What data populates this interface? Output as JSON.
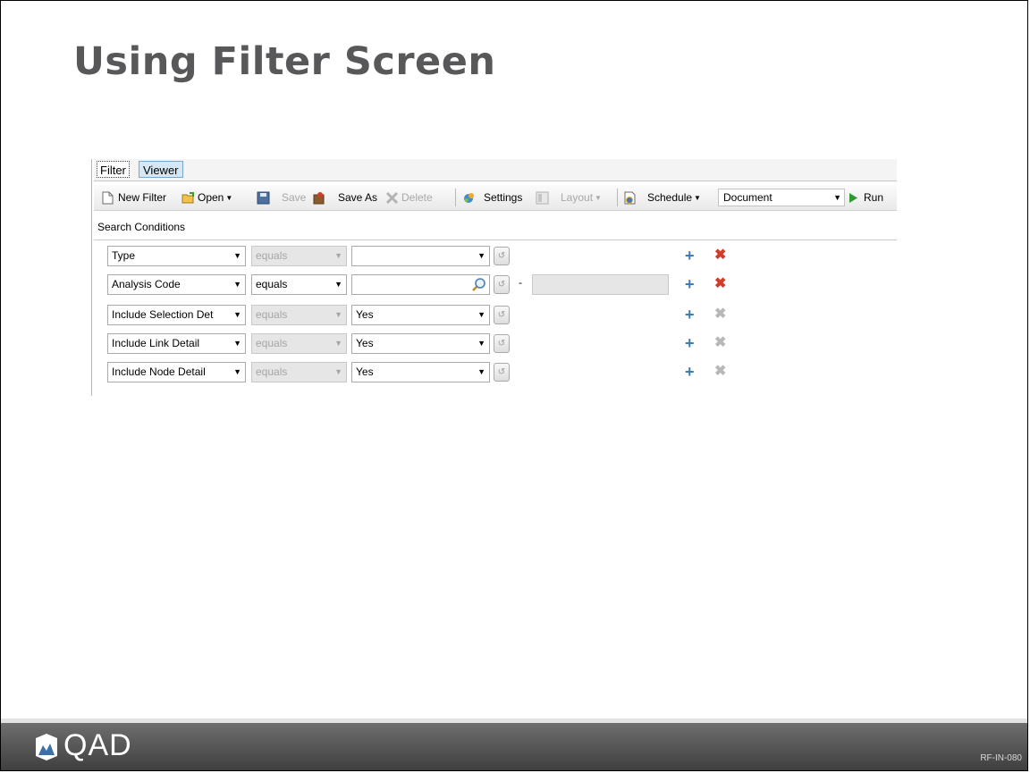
{
  "slide": {
    "title": "Using Filter Screen"
  },
  "tabs": [
    {
      "label": "Filter"
    },
    {
      "label": "Viewer"
    }
  ],
  "toolbar": {
    "new_filter": "New Filter",
    "open": "Open",
    "save": "Save",
    "save_as": "Save As",
    "delete": "Delete",
    "settings": "Settings",
    "layout": "Layout",
    "schedule": "Schedule",
    "output_select": "Document",
    "run": "Run"
  },
  "search": {
    "section_label": "Search Conditions",
    "range_dash": "-",
    "rows": [
      {
        "field": "Type",
        "operator": "equals",
        "value": ""
      },
      {
        "field": "Analysis Code",
        "operator": "equals",
        "value": ""
      },
      {
        "field": "Include Selection Det",
        "operator": "equals",
        "value": "Yes"
      },
      {
        "field": "Include Link Detail",
        "operator": "equals",
        "value": "Yes"
      },
      {
        "field": "Include Node Detail",
        "operator": "equals",
        "value": "Yes"
      }
    ]
  },
  "footer": {
    "brand": "QAD",
    "code": "RF-IN-080"
  },
  "colors": {
    "title": "#58585a",
    "accent": "#3d7ab8",
    "remove": "#d23b2b",
    "footer": "#4a4a4a"
  }
}
